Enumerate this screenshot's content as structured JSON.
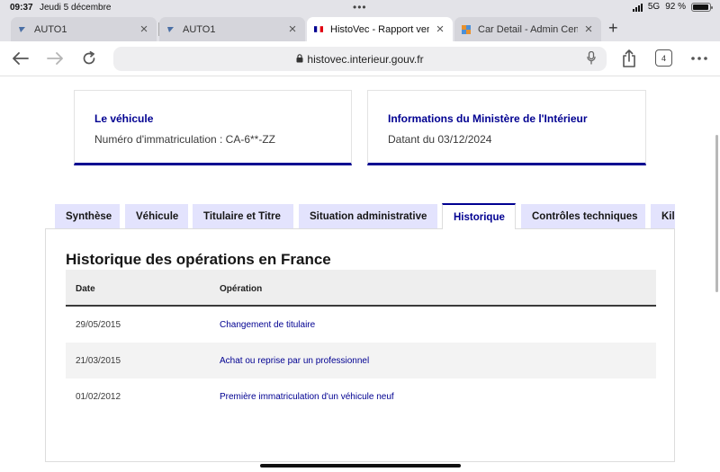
{
  "status_bar": {
    "time": "09:37",
    "date": "Jeudi 5 décembre",
    "network": "5G",
    "battery": "92 %",
    "battery_level": 0.92
  },
  "browser": {
    "tabs": [
      {
        "title": "AUTO1",
        "active": false
      },
      {
        "title": "AUTO1",
        "active": false
      },
      {
        "title": "HistoVec - Rapport vendeur",
        "active": true
      },
      {
        "title": "Car Detail - Admin Center",
        "active": false
      }
    ],
    "new_tab_label": "+",
    "address": "histovec.interieur.gouv.fr",
    "tab_count": "4"
  },
  "cards": [
    {
      "title": "Le véhicule",
      "value": "Numéro d'immatriculation : CA-6**-ZZ"
    },
    {
      "title": "Informations du Ministère de l'Intérieur",
      "value": "Datant du 03/12/2024"
    }
  ],
  "nav_tabs": [
    {
      "label": "Synthèse",
      "active": false
    },
    {
      "label": "Véhicule",
      "active": false
    },
    {
      "label": "Titulaire et Titre",
      "active": false
    },
    {
      "label": "Situation administrative",
      "active": false
    },
    {
      "label": "Historique",
      "active": true
    },
    {
      "label": "Contrôles techniques",
      "active": false
    },
    {
      "label": "Kilo",
      "active": false
    }
  ],
  "section": {
    "title": "Historique des opérations en France",
    "columns": [
      "Date",
      "Opération"
    ],
    "rows": [
      {
        "date": "29/05/2015",
        "operation": "Changement de titulaire"
      },
      {
        "date": "21/03/2015",
        "operation": "Achat ou reprise par un professionnel"
      },
      {
        "date": "01/02/2012",
        "operation": "Première immatriculation d'un véhicule neuf"
      }
    ]
  },
  "colors": {
    "accent": "#000091",
    "tab_bg": "#e3e3fd",
    "chrome": "#e3e3e8"
  }
}
